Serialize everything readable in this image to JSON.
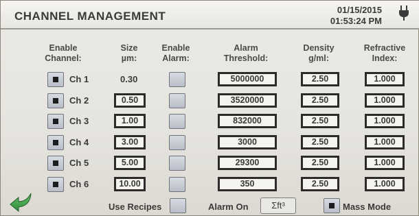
{
  "header": {
    "title": "CHANNEL MANAGEMENT",
    "date": "01/15/2015",
    "time": "01:53:24 PM",
    "power_icon": "plug-icon"
  },
  "columns": {
    "enable_channel": [
      "Enable",
      "Channel:"
    ],
    "size": [
      "Size",
      "µm:"
    ],
    "enable_alarm": [
      "Enable",
      "Alarm:"
    ],
    "alarm_threshold": [
      "Alarm",
      "Threshold:"
    ],
    "density": [
      "Density",
      "g/ml:"
    ],
    "refractive": [
      "Refractive",
      "Index:"
    ]
  },
  "channels": [
    {
      "label": "Ch 1",
      "enabled": true,
      "size": "0.30",
      "alarm_enabled": false,
      "threshold": "5000000",
      "density": "2.50",
      "refractive": "1.000"
    },
    {
      "label": "Ch 2",
      "enabled": true,
      "size": "0.50",
      "alarm_enabled": false,
      "threshold": "3520000",
      "density": "2.50",
      "refractive": "1.000"
    },
    {
      "label": "Ch 3",
      "enabled": true,
      "size": "1.00",
      "alarm_enabled": false,
      "threshold": "832000",
      "density": "2.50",
      "refractive": "1.000"
    },
    {
      "label": "Ch 4",
      "enabled": true,
      "size": "3.00",
      "alarm_enabled": false,
      "threshold": "3000",
      "density": "2.50",
      "refractive": "1.000"
    },
    {
      "label": "Ch 5",
      "enabled": true,
      "size": "5.00",
      "alarm_enabled": false,
      "threshold": "29300",
      "density": "2.50",
      "refractive": "1.000"
    },
    {
      "label": "Ch 6",
      "enabled": true,
      "size": "10.00",
      "alarm_enabled": false,
      "threshold": "350",
      "density": "2.50",
      "refractive": "1.000"
    }
  ],
  "footer": {
    "back_icon": "back-arrow-icon",
    "use_recipes_label": "Use Recipes",
    "use_recipes_checked": false,
    "alarm_on_label": "Alarm On",
    "alarm_units": "Σft³",
    "mass_mode_label": "Mass Mode",
    "mass_mode_checked": true
  }
}
